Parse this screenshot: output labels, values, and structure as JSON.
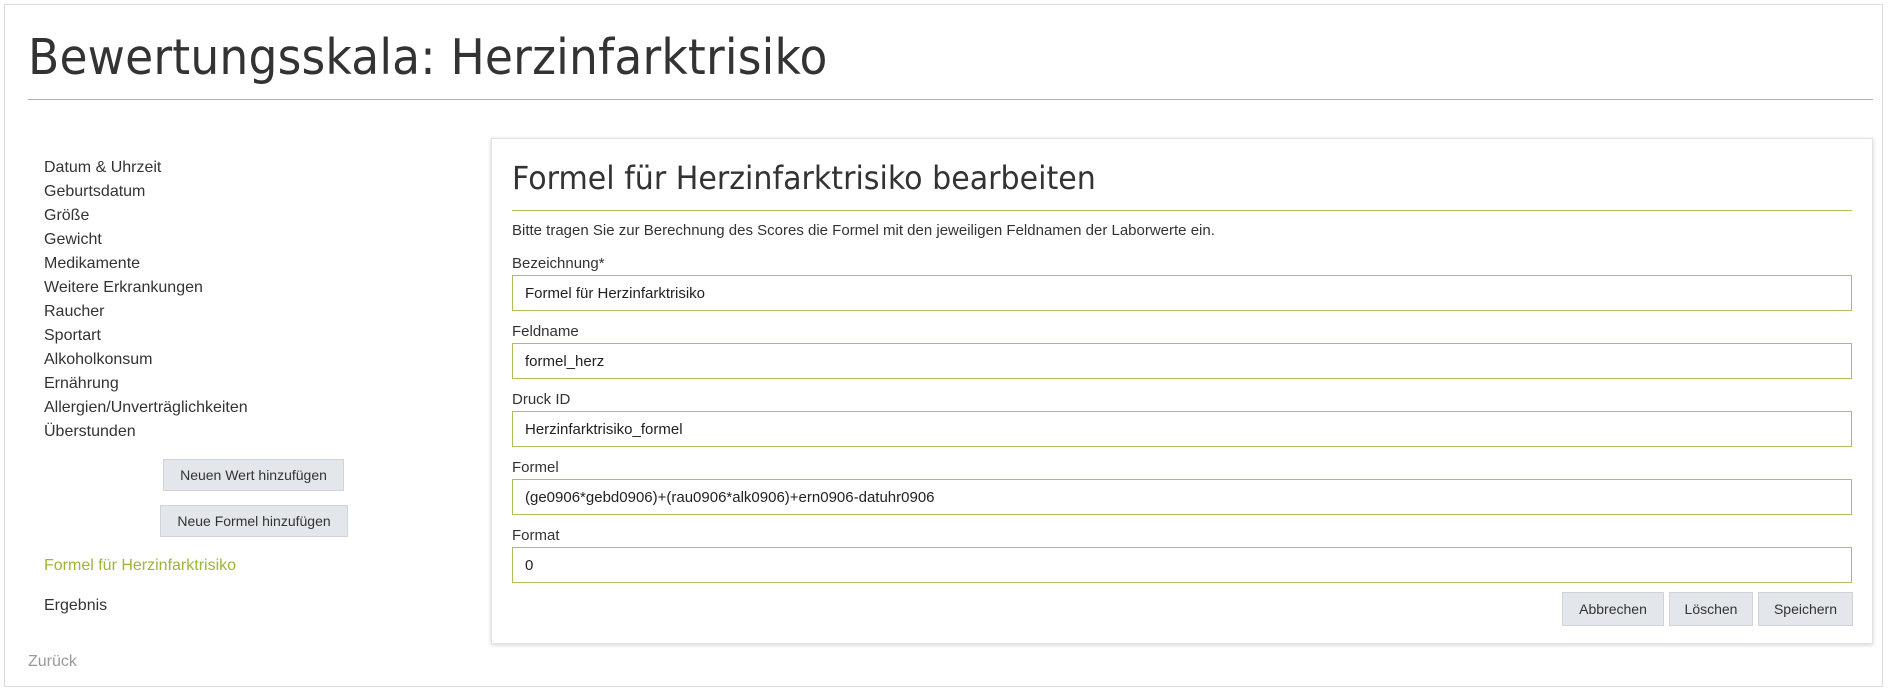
{
  "page": {
    "title": "Bewertungsskala: Herzinfarktrisiko"
  },
  "sidebar": {
    "items": [
      {
        "label": "Datum & Uhrzeit"
      },
      {
        "label": "Geburtsdatum"
      },
      {
        "label": "Größe"
      },
      {
        "label": "Gewicht"
      },
      {
        "label": "Medikamente"
      },
      {
        "label": "Weitere Erkrankungen"
      },
      {
        "label": "Raucher"
      },
      {
        "label": "Sportart"
      },
      {
        "label": "Alkoholkonsum"
      },
      {
        "label": "Ernährung"
      },
      {
        "label": "Allergien/Unverträglichkeiten"
      },
      {
        "label": "Überstunden"
      }
    ],
    "add_value_label": "Neuen Wert hinzufügen",
    "add_formula_label": "Neue Formel hinzufügen",
    "active_formula": "Formel für Herzinfarktrisiko",
    "result_label": "Ergebnis",
    "back_label": "Zurück"
  },
  "panel": {
    "title": "Formel für Herzinfarktrisiko bearbeiten",
    "description": "Bitte tragen Sie zur Berechnung des Scores die Formel mit den jeweiligen Feldnamen der Laborwerte ein.",
    "fields": {
      "bezeichnung": {
        "label": "Bezeichnung*",
        "value": "Formel für Herzinfarktrisiko"
      },
      "feldname": {
        "label": "Feldname",
        "value": "formel_herz"
      },
      "druck_id": {
        "label": "Druck ID",
        "value": "Herzinfarktrisiko_formel"
      },
      "formel": {
        "label": "Formel",
        "value": "(ge0906*gebd0906)+(rau0906*alk0906)+ern0906-datuhr0906"
      },
      "format": {
        "label": "Format",
        "value": "0"
      }
    },
    "buttons": {
      "cancel": "Abbrechen",
      "delete": "Löschen",
      "save": "Speichern"
    }
  },
  "colors": {
    "accent": "#a8c35a",
    "active_link": "#9bb73a",
    "button_bg": "#e3e6ea"
  }
}
